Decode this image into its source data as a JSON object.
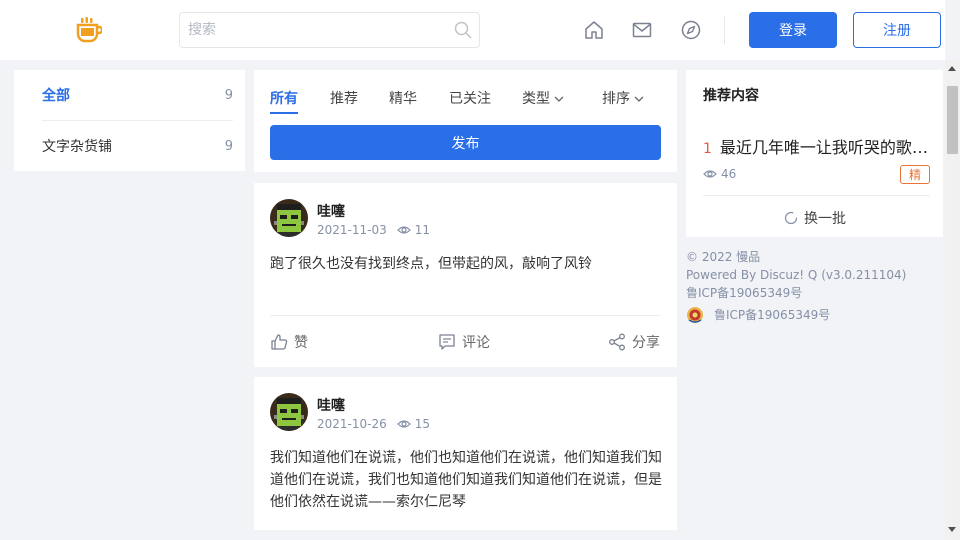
{
  "header": {
    "search_placeholder": "搜索",
    "login_label": "登录",
    "register_label": "注册"
  },
  "sidebar": {
    "items": [
      {
        "label": "全部",
        "count": "9"
      },
      {
        "label": "文字杂货铺",
        "count": "9"
      }
    ]
  },
  "tabs": {
    "items": [
      {
        "label": "所有"
      },
      {
        "label": "推荐"
      },
      {
        "label": "精华"
      },
      {
        "label": "已关注"
      },
      {
        "label": "类型"
      },
      {
        "label": "排序"
      }
    ],
    "publish_label": "发布"
  },
  "posts": [
    {
      "author": "哇噻",
      "date": "2021-11-03",
      "views": "11",
      "content": "跑了很久也没有找到终点，但带起的风，敲响了风铃",
      "like_label": "赞",
      "comment_label": "评论",
      "share_label": "分享"
    },
    {
      "author": "哇噻",
      "date": "2021-10-26",
      "views": "15",
      "content": "我们知道他们在说谎，他们也知道他们在说谎，他们知道我们知道他们在说谎，我们也知道他们知道我们知道他们在说谎，但是他们依然在说谎——索尔仁尼琴"
    }
  ],
  "recommend": {
    "title": "推荐内容",
    "items": [
      {
        "rank": "1",
        "title": "最近几年唯一让我听哭的歌 ...",
        "views": "46",
        "badge": "精"
      }
    ],
    "refresh_label": "换一批"
  },
  "footer": {
    "copyright": "© 2022 慢品",
    "powered": "Powered By Discuz! Q (v3.0.211104)",
    "icp": "鲁ICP备19065349号",
    "icp_police": "鲁ICP备19065349号"
  },
  "colors": {
    "accent": "#2a6ee8",
    "logo": "#f0a01e",
    "badge": "#e8743a"
  }
}
